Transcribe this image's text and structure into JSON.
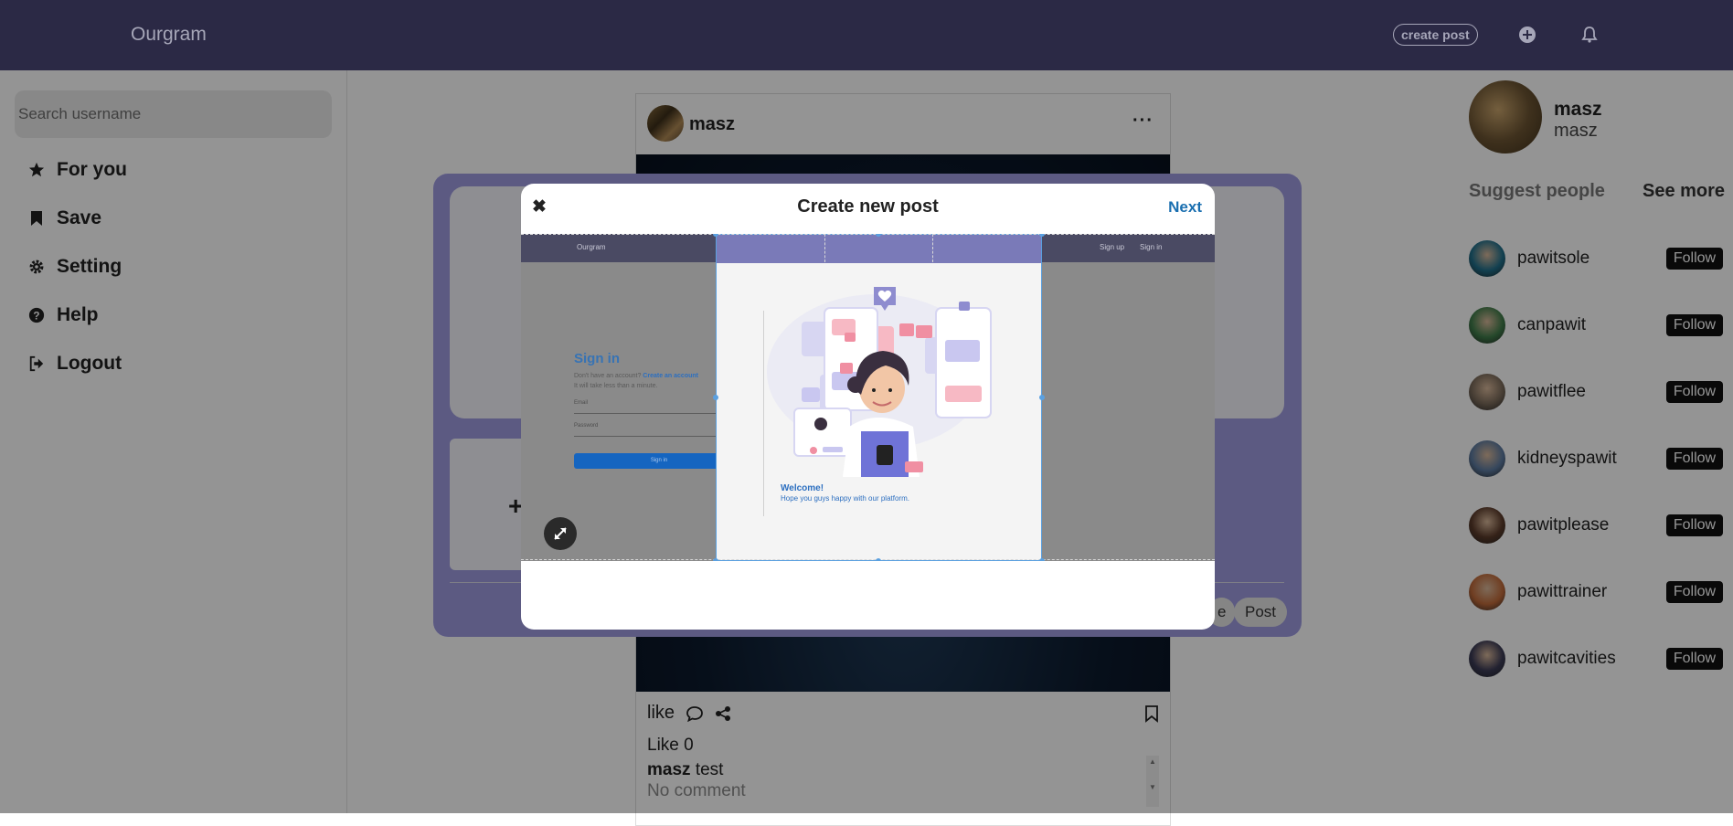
{
  "topbar": {
    "brand": "Ourgram",
    "create_post_label": "create post",
    "icons": [
      "plus-circle-icon",
      "bell-icon"
    ]
  },
  "sidebar": {
    "search_placeholder": "Search username",
    "items": [
      {
        "label": "For you",
        "icon": "star-icon"
      },
      {
        "label": "Save",
        "icon": "bookmark-icon"
      },
      {
        "label": "Setting",
        "icon": "gear-icon"
      },
      {
        "label": "Help",
        "icon": "question-icon"
      },
      {
        "label": "Logout",
        "icon": "logout-icon"
      }
    ]
  },
  "feed": {
    "username": "masz",
    "menu_glyph": "···",
    "like_label": "like",
    "likes_text": "Like 0",
    "caption_user": "masz",
    "caption_text": "test",
    "comment_text": "No comment"
  },
  "profile": {
    "name": "masz",
    "handle": "masz"
  },
  "suggestions": {
    "title": "Suggest people",
    "see_more": "See more",
    "follow_label": "Follow",
    "people": [
      {
        "name": "pawitsole",
        "color": "#1f6f8b"
      },
      {
        "name": "canpawit",
        "color": "#3f7c4a"
      },
      {
        "name": "pawitflee",
        "color": "#7a6a5a"
      },
      {
        "name": "kidneyspawit",
        "color": "#5c7aa0"
      },
      {
        "name": "pawitplease",
        "color": "#5a3a2a"
      },
      {
        "name": "pawittrainer",
        "color": "#c06a3a"
      },
      {
        "name": "pawitcavities",
        "color": "#3a3a55"
      }
    ]
  },
  "compose_background": {
    "plus_glyph": "+",
    "partial_button": "e",
    "post_button": "Post"
  },
  "modal": {
    "close_glyph": "✖",
    "title": "Create new post",
    "next_label": "Next",
    "preview": {
      "brand": "Ourgram",
      "nav_signup": "Sign up",
      "nav_signin": "Sign in",
      "signin_title": "Sign in",
      "no_account_text": "Don't have an account?",
      "create_account_link": "Create an account",
      "tagline": "It will take less than a minute.",
      "email_label": "Email",
      "password_label": "Password",
      "signin_button": "Sign in",
      "welcome_title": "Welcome!",
      "welcome_sub": "Hope you guys happy with our platform."
    }
  },
  "colors": {
    "topbar": "#2b2945",
    "accent_blue": "#1a6fb0",
    "compose_panel": "#9f9ce0",
    "crop_border": "#5aa0e0"
  }
}
